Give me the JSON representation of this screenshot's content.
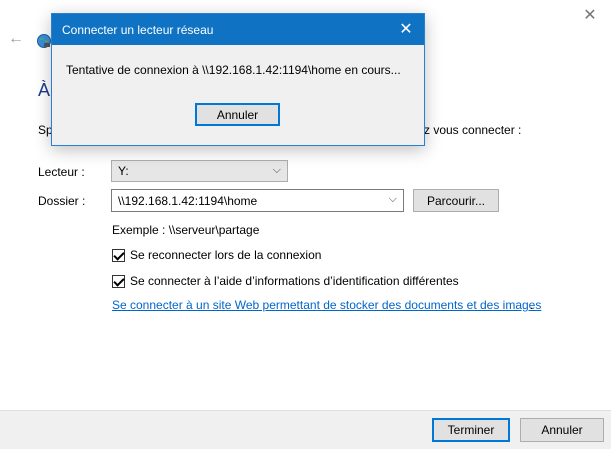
{
  "background": {
    "heading_char": "À",
    "intro_left": "Sp",
    "intro_right": "z vous connecter :",
    "drive_label": "Lecteur :",
    "drive_value": "Y:",
    "folder_label": "Dossier :",
    "folder_value": "\\\\192.168.1.42:1194\\home",
    "browse_label": "Parcourir...",
    "example_text": "Exemple : \\\\serveur\\partage",
    "reconnect_label": "Se reconnecter lors de la connexion",
    "reconnect_checked": true,
    "creds_label": "Se connecter à l’aide d’informations d’identification différentes",
    "creds_checked": true,
    "web_link": "Se connecter à un site Web permettant de stocker des documents et des images",
    "web_link_dot": ".",
    "finish_label": "Terminer",
    "cancel_label": "Annuler"
  },
  "modal": {
    "title": "Connecter un lecteur réseau",
    "message": "Tentative de connexion à \\\\192.168.1.42:1194\\home en cours...",
    "cancel_label": "Annuler"
  },
  "colors": {
    "accent": "#0078d7",
    "title_bar": "#0f72c3",
    "link": "#0066cc"
  },
  "icons": [
    "back-arrow-icon",
    "globe-network-icon",
    "close-icon",
    "chevron-down-icon",
    "checkmark-icon"
  ]
}
